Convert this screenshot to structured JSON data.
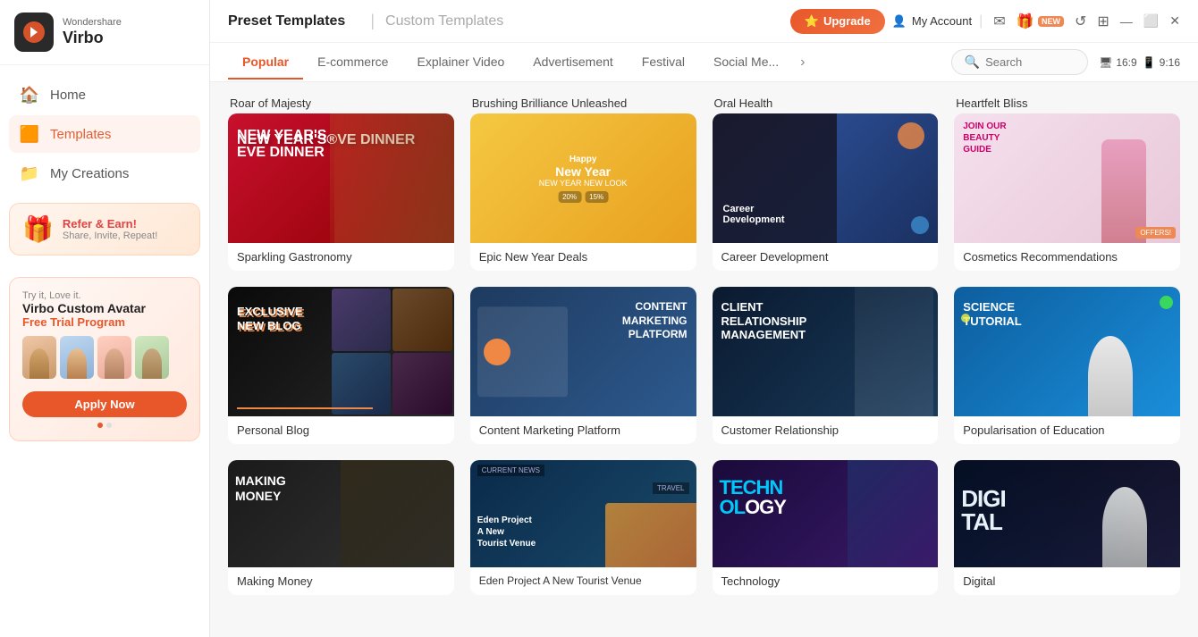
{
  "app": {
    "brand": "Wondershare",
    "name": "Virbo"
  },
  "titlebar": {
    "upgrade_label": "Upgrade",
    "account_label": "My Account",
    "preset_tab": "Preset Templates",
    "custom_tab": "Custom Templates"
  },
  "nav": {
    "home": "Home",
    "templates": "Templates",
    "my_creations": "My Creations"
  },
  "promo": {
    "refer_title": "Refer & Earn!",
    "refer_sub": "Share, Invite, Repeat!",
    "try_label": "Try it, Love it.",
    "avatar_title": "Virbo Custom Avatar",
    "free_trial": "Free Trial Program",
    "apply_btn": "Apply Now"
  },
  "tabs": [
    {
      "id": "popular",
      "label": "Popular",
      "active": true
    },
    {
      "id": "ecommerce",
      "label": "E-commerce",
      "active": false
    },
    {
      "id": "explainer",
      "label": "Explainer Video",
      "active": false
    },
    {
      "id": "advertisement",
      "label": "Advertisement",
      "active": false
    },
    {
      "id": "festival",
      "label": "Festival",
      "active": false
    },
    {
      "id": "social",
      "label": "Social Me...",
      "active": false
    }
  ],
  "search": {
    "placeholder": "Search"
  },
  "ratios": {
    "landscape": "16:9",
    "portrait": "9:16"
  },
  "templates_row1": [
    {
      "id": "t1",
      "label": "Sparkling Gastronomy",
      "thumb_type": "sparkling"
    },
    {
      "id": "t2",
      "label": "Epic New Year Deals",
      "thumb_type": "epic"
    },
    {
      "id": "t3",
      "label": "Career Development",
      "thumb_type": "career"
    },
    {
      "id": "t4",
      "label": "Cosmetics Recommendations",
      "thumb_type": "cosmetics"
    }
  ],
  "templates_row2": [
    {
      "id": "t5",
      "label": "Personal Blog",
      "thumb_type": "blog"
    },
    {
      "id": "t6",
      "label": "Content Marketing Platform",
      "thumb_type": "content"
    },
    {
      "id": "t7",
      "label": "Customer Relationship",
      "thumb_type": "customer"
    },
    {
      "id": "t8",
      "label": "Popularisation of Education",
      "thumb_type": "popular"
    }
  ],
  "templates_row3": [
    {
      "id": "t9",
      "label": "Making Money",
      "thumb_type": "making"
    },
    {
      "id": "t10",
      "label": "Eden Project A New Tourist Venue",
      "thumb_type": "news"
    },
    {
      "id": "t11",
      "label": "Technology",
      "thumb_type": "tech"
    },
    {
      "id": "t12",
      "label": "Digital",
      "thumb_type": "digital"
    }
  ],
  "above_fold_labels": [
    "Roar of Majesty",
    "Brushing Brilliance Unleashed",
    "Oral Health",
    "Heartfelt Bliss"
  ]
}
